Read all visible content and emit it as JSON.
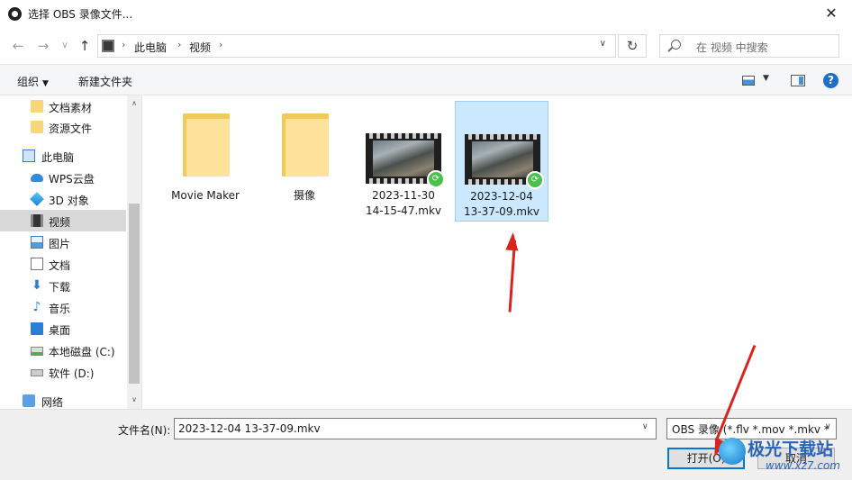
{
  "window": {
    "title": "选择 OBS 录像文件...",
    "close_glyph": "✕"
  },
  "nav": {
    "back_glyph": "←",
    "forward_glyph": "→",
    "recent_glyph": "∨",
    "up_glyph": "↑",
    "breadcrumb": [
      "此电脑",
      "视频"
    ],
    "separator": "›",
    "refresh_glyph": "↻",
    "search_placeholder": "在 视频 中搜索"
  },
  "toolbar": {
    "organize": "组织",
    "new_folder": "新建文件夹",
    "caret": "▼",
    "help": "?"
  },
  "sidebar": {
    "items": [
      {
        "label": "文档素材",
        "icon": "folder-icon"
      },
      {
        "label": "资源文件",
        "icon": "folder-icon"
      },
      {
        "label": "此电脑",
        "icon": "computer-icon"
      },
      {
        "label": "WPS云盘",
        "icon": "cloud-icon"
      },
      {
        "label": "3D 对象",
        "icon": "cube-icon"
      },
      {
        "label": "视频",
        "icon": "video-icon",
        "selected": true
      },
      {
        "label": "图片",
        "icon": "picture-icon"
      },
      {
        "label": "文档",
        "icon": "document-icon"
      },
      {
        "label": "下载",
        "icon": "download-icon"
      },
      {
        "label": "音乐",
        "icon": "music-icon"
      },
      {
        "label": "桌面",
        "icon": "desktop-icon"
      },
      {
        "label": "本地磁盘 (C:)",
        "icon": "drive-icon"
      },
      {
        "label": "软件 (D:)",
        "icon": "drive-icon"
      },
      {
        "label": "网络",
        "icon": "network-icon"
      }
    ],
    "scroll_up": "∧",
    "scroll_down": "∨"
  },
  "files": [
    {
      "name": "Movie Maker",
      "type": "folder"
    },
    {
      "name": "摄像",
      "type": "folder"
    },
    {
      "name_line1": "2023-11-30",
      "name_line2": "14-15-47.mkv",
      "type": "video"
    },
    {
      "name_line1": "2023-12-04",
      "name_line2": "13-37-09.mkv",
      "type": "video",
      "selected": true
    }
  ],
  "footer": {
    "filename_label": "文件名(N):",
    "filename_value": "2023-12-04 13-37-09.mkv",
    "filetype_value": "OBS 录像 (*.flv *.mov *.mkv *",
    "dropdown_glyph": "∨",
    "open_button": "打开(O)",
    "cancel_button": "取消"
  },
  "annotations": {
    "arrow_color": "#d9231f"
  },
  "watermark": {
    "text": "极光下载站",
    "sub": "www.xz7.com"
  }
}
